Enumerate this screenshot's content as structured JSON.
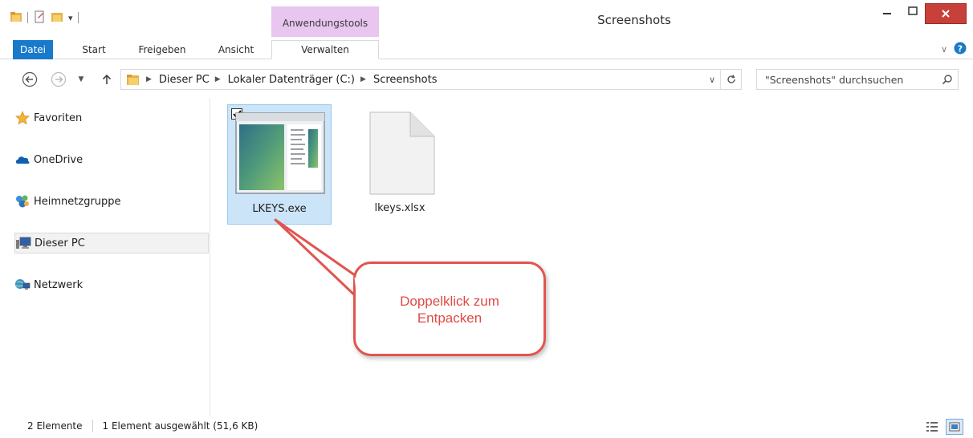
{
  "window": {
    "title": "Screenshots",
    "context_tab_group": "Anwendungstools"
  },
  "ribbon": {
    "tabs": [
      {
        "label": "Datei"
      },
      {
        "label": "Start"
      },
      {
        "label": "Freigeben"
      },
      {
        "label": "Ansicht"
      },
      {
        "label": "Verwalten"
      }
    ]
  },
  "address": {
    "crumbs": [
      "Dieser PC",
      "Lokaler Datenträger (C:)",
      "Screenshots"
    ],
    "search_placeholder": "\"Screenshots\" durchsuchen"
  },
  "navpane": {
    "items": [
      {
        "label": "Favoriten",
        "icon": "star-icon"
      },
      {
        "label": "OneDrive",
        "icon": "cloud-icon"
      },
      {
        "label": "Heimnetzgruppe",
        "icon": "homegroup-icon"
      },
      {
        "label": "Dieser PC",
        "icon": "computer-icon"
      },
      {
        "label": "Netzwerk",
        "icon": "network-icon"
      }
    ],
    "selected": "Dieser PC"
  },
  "files": [
    {
      "name": "LKEYS.exe",
      "icon": "application-thumbnail",
      "selected": true,
      "checked": true
    },
    {
      "name": "lkeys.xlsx",
      "icon": "blank-document-icon",
      "selected": false
    }
  ],
  "callout": {
    "line1": "Doppelklick zum",
    "line2": "Entpacken"
  },
  "statusbar": {
    "item_count": "2 Elemente",
    "selection": "1 Element ausgewählt (51,6 KB)"
  },
  "colors": {
    "file_tab": "#1979ca",
    "context_tab": "#e8c6f0",
    "close_button": "#c7413a",
    "selection_fill": "#cce4f7",
    "callout_red": "#e0554e"
  }
}
